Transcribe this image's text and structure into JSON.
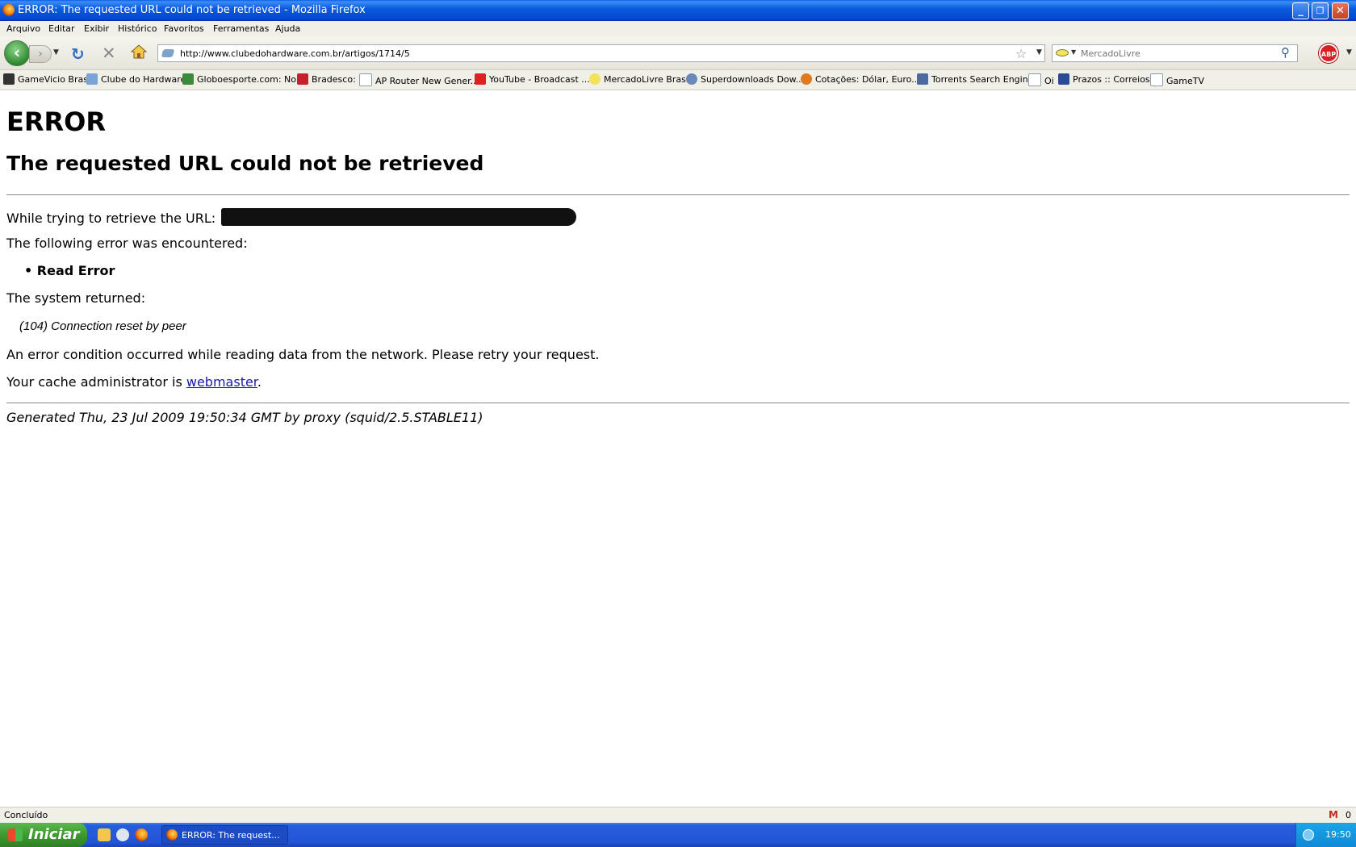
{
  "window": {
    "title": "ERROR: The requested URL could not be retrieved - Mozilla Firefox",
    "controls": {
      "minimize": "_",
      "maximize": "❐",
      "close": "✕"
    }
  },
  "menu": [
    "Arquivo",
    "Editar",
    "Exibir",
    "Histórico",
    "Favoritos",
    "Ferramentas",
    "Ajuda"
  ],
  "toolbar": {
    "url": "http://www.clubedohardware.com.br/artigos/1714/5",
    "search_placeholder": "MercadoLivre",
    "abp_label": "ABP"
  },
  "bookmarks": [
    "GameVicio Brasil",
    "Clube do Hardware",
    "Globoesporte.com: No...",
    "Bradesco:",
    "AP Router New Gener...",
    "YouTube - Broadcast ...",
    "MercadoLivre Brasil",
    "Superdownloads Dow...",
    "Cotações: Dólar, Euro...",
    "Torrents Search Engine",
    "Oi",
    "Prazos :: Correios",
    "GameTV"
  ],
  "page": {
    "heading": "ERROR",
    "subheading": "The requested URL could not be retrieved",
    "url_line_prefix": "While trying to retrieve the URL:",
    "error_intro": "The following error was encountered:",
    "error_item": "Read Error",
    "system_returned": "The system returned:",
    "system_message": "(104) Connection reset by peer",
    "description": "An error condition occurred while reading data from the network. Please retry your request.",
    "admin_prefix": "Your cache administrator is ",
    "admin_link": "webmaster",
    "admin_suffix": ".",
    "generated": "Generated Thu, 23 Jul 2009 19:50:34 GMT by proxy (squid/2.5.STABLE11)"
  },
  "status": {
    "text": "Concluído",
    "gmail_count": "0"
  },
  "taskbar": {
    "start_label": "Iniciar",
    "task_label": "ERROR: The request...",
    "clock": "19:50"
  }
}
